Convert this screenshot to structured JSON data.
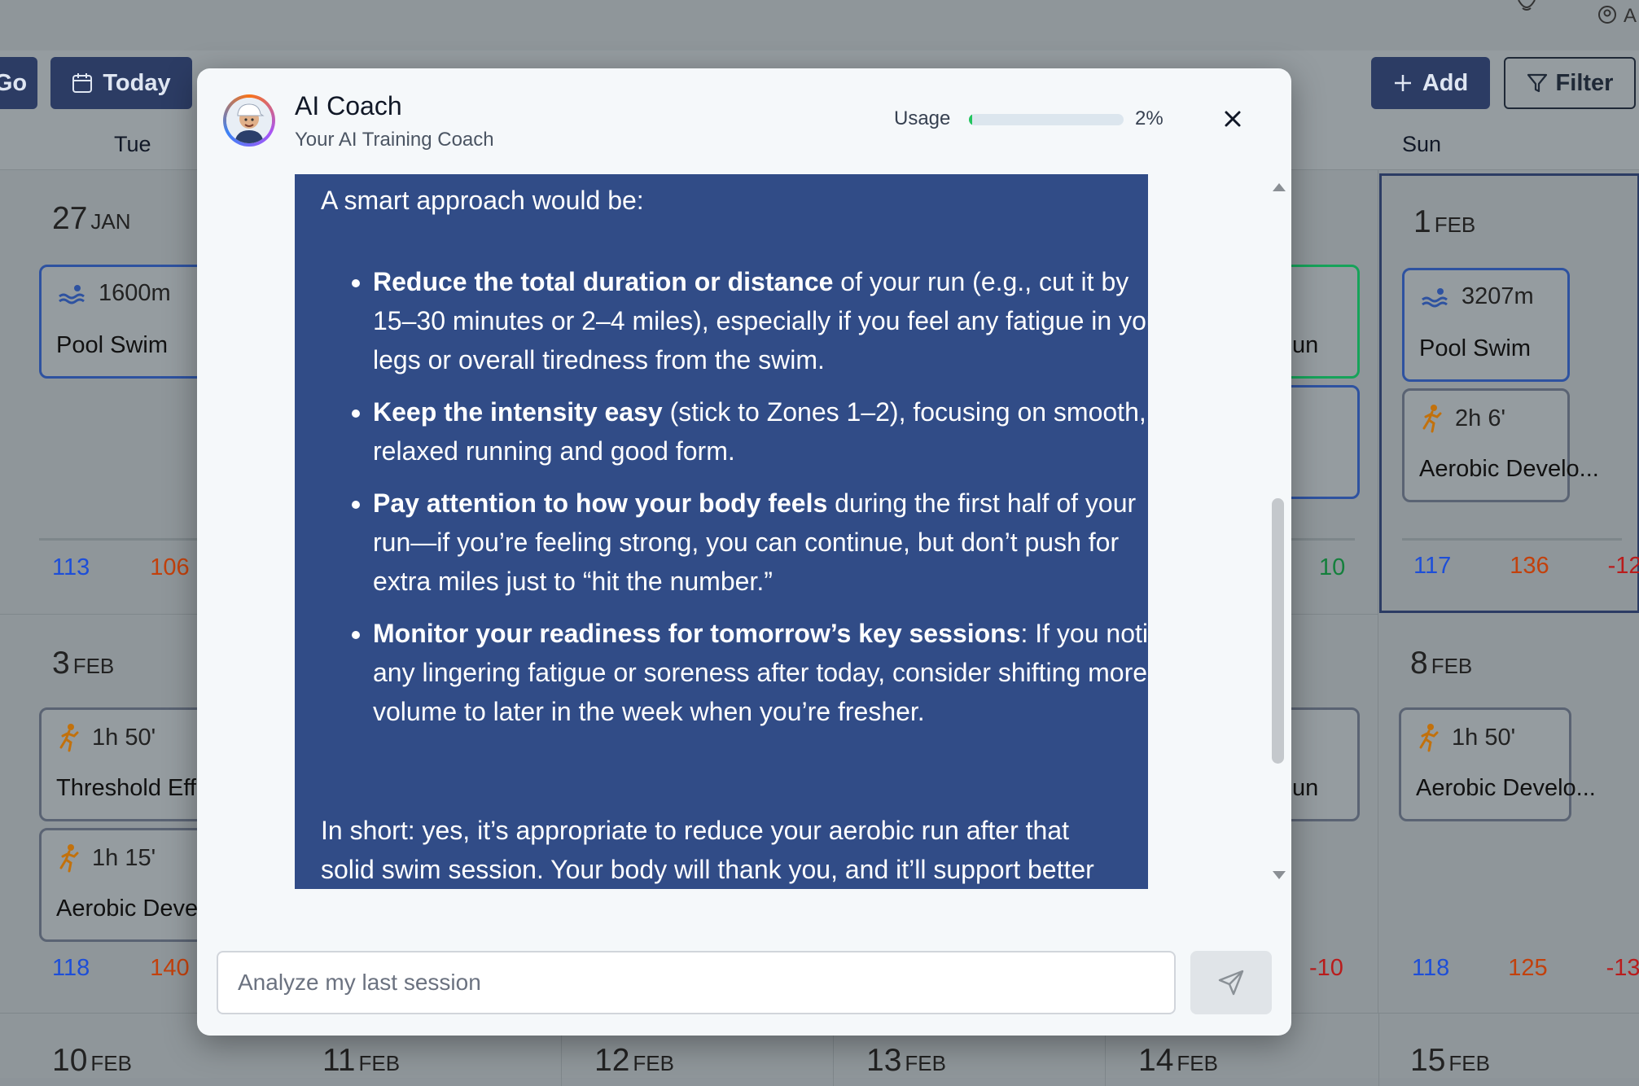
{
  "background": {
    "toolbar": {
      "go_label": "Go",
      "today_label": "Today",
      "add_label": "Add",
      "filter_label": "Filter",
      "top_right_initial": "A"
    },
    "day_headers": {
      "tue": "Tue",
      "sun": "Sun"
    },
    "dates": {
      "d27": {
        "num": "27",
        "mon": "JAN"
      },
      "d1": {
        "num": "1",
        "mon": "FEB"
      },
      "d3": {
        "num": "3",
        "mon": "FEB"
      },
      "d8": {
        "num": "8",
        "mon": "FEB"
      },
      "d10": {
        "num": "10",
        "mon": "FEB"
      },
      "d11": {
        "num": "11",
        "mon": "FEB"
      },
      "d12": {
        "num": "12",
        "mon": "FEB"
      },
      "d13": {
        "num": "13",
        "mon": "FEB"
      },
      "d14": {
        "num": "14",
        "mon": "FEB"
      },
      "d15": {
        "num": "15",
        "mon": "FEB"
      }
    },
    "cards": {
      "tue_swim": {
        "meta": "1600m",
        "name": "Pool Swim"
      },
      "sun_swim": {
        "meta": "3207m",
        "name": "Pool Swim"
      },
      "sun_run": {
        "meta": "2h 6'",
        "name": "Aerobic Develo..."
      },
      "sat_green": {
        "name": "un"
      },
      "mon2_thresh": {
        "meta": "1h 50'",
        "name": "Threshold Eff"
      },
      "mon2_aero": {
        "meta": "1h 15'",
        "name": "Aerobic Deve"
      },
      "sat2": {
        "name": "un"
      },
      "sun2_run": {
        "meta": "1h 50'",
        "name": "Aerobic Develo..."
      }
    },
    "stats": {
      "tue1": [
        "113",
        "106"
      ],
      "sat1": [
        "10"
      ],
      "sun1": [
        "117",
        "136",
        "-12"
      ],
      "tue2": [
        "118",
        "140"
      ],
      "sat2": [
        "-10"
      ],
      "sun2": [
        "118",
        "125",
        "-13"
      ]
    }
  },
  "modal": {
    "title": "AI Coach",
    "subtitle": "Your AI Training Coach",
    "usage_label": "Usage",
    "usage_value": 0.02,
    "usage_pct": "2%",
    "message": {
      "intro": "A smart approach would be:",
      "bullets": [
        {
          "bold": "Reduce the total duration or distance",
          "text": " of your run (e.g., cut it by 15–30 minutes or 2–4 miles), especially if you feel any fatigue in your legs or overall tiredness from the swim."
        },
        {
          "bold": "Keep the intensity easy",
          "text": " (stick to Zones 1–2), focusing on smooth, relaxed running and good form."
        },
        {
          "bold": "Pay attention to how your body feels",
          "text": " during the first half of your run—if you’re feeling strong, you can continue, but don’t push for extra miles just to “hit the number.”"
        },
        {
          "bold": "Monitor your readiness for tomorrow’s key sessions",
          "text": ": If you notice any lingering fatigue or soreness after today, consider shifting more volume to later in the week when you’re fresher."
        }
      ],
      "summary": "In short: yes, it’s appropriate to reduce your aerobic run after that solid swim session. Your body will thank you, and it’ll support better recovery and growth for your marathon build."
    },
    "input_placeholder": "Analyze my last session",
    "colors": {
      "bubble": "#314c87",
      "usage_fill": "#22c55e"
    }
  }
}
